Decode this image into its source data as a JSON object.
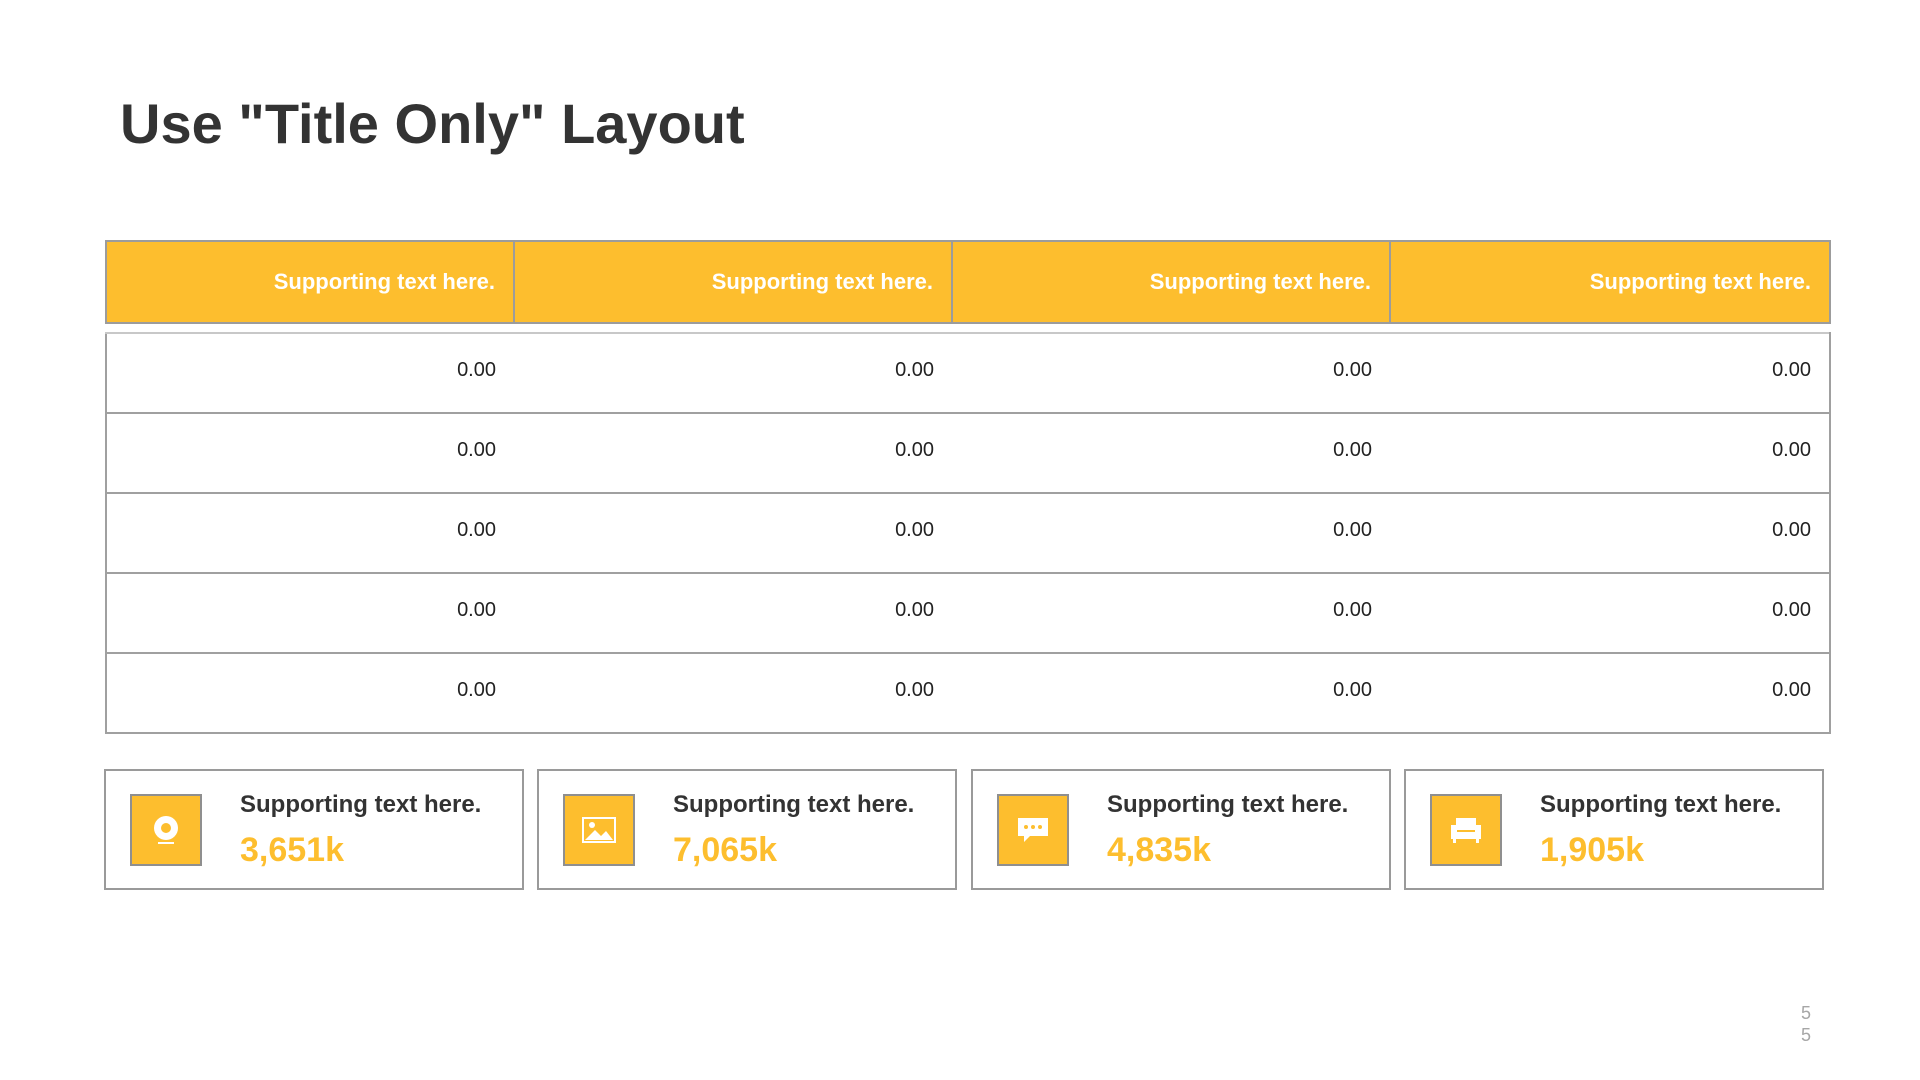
{
  "slide": {
    "title": "Use \"Title Only\" Layout",
    "page_number": "55"
  },
  "table": {
    "headers": [
      "Supporting text here.",
      "Supporting text here.",
      "Supporting text here.",
      "Supporting text here."
    ],
    "rows": [
      [
        "0.00",
        "0.00",
        "0.00",
        "0.00"
      ],
      [
        "0.00",
        "0.00",
        "0.00",
        "0.00"
      ],
      [
        "0.00",
        "0.00",
        "0.00",
        "0.00"
      ],
      [
        "0.00",
        "0.00",
        "0.00",
        "0.00"
      ],
      [
        "0.00",
        "0.00",
        "0.00",
        "0.00"
      ]
    ]
  },
  "cards": [
    {
      "icon": "webcam-icon",
      "label": "Supporting text here.",
      "value": "3,651k"
    },
    {
      "icon": "image-icon",
      "label": "Supporting text here.",
      "value": "7,065k"
    },
    {
      "icon": "chat-bubble-icon",
      "label": "Supporting text here.",
      "value": "4,835k"
    },
    {
      "icon": "armchair-icon",
      "label": "Supporting text here.",
      "value": "1,905k"
    }
  ],
  "colors": {
    "accent": "#FDBE2E",
    "title_text": "#333333",
    "border": "#9C9C9C"
  }
}
